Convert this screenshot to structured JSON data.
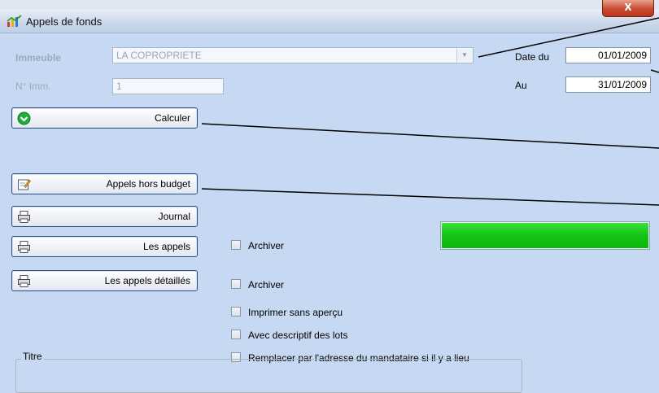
{
  "window": {
    "title": "Appels de fonds",
    "close_label": "X"
  },
  "form": {
    "immeuble_label": "Immeuble",
    "immeuble_value": "LA COPROPRIETE",
    "num_imm_label": "N° Imm.",
    "num_imm_value": "1",
    "date_du_label": "Date du",
    "date_du_value": "01/01/2009",
    "au_label": "Au",
    "au_value": "31/01/2009"
  },
  "buttons": {
    "calculer": "Calculer",
    "appels_hors_budget": "Appels hors budget",
    "journal": "Journal",
    "les_appels": "Les appels",
    "les_appels_detailles": "Les appels détaillés"
  },
  "checkboxes": {
    "archiver_1": "Archiver",
    "archiver_2": "Archiver",
    "imprimer_sans_apercu": "Imprimer sans aperçu",
    "avec_descriptif": "Avec descriptif des lots",
    "remplacer_adresse": "Remplacer par l'adresse du mandataire si il y a lieu"
  },
  "progress": {
    "fraction": 1.0,
    "color": "#12c412"
  },
  "group": {
    "titre_label": "Titre"
  },
  "icons": {
    "app": "chart-icon",
    "calculer": "green-check-icon",
    "appels_hors_budget": "edit-form-icon",
    "print": "printer-icon"
  }
}
